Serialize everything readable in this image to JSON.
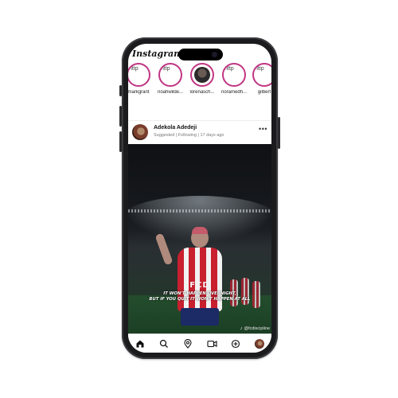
{
  "app": {
    "title": "Instagram"
  },
  "stories": [
    {
      "label": "markgrant",
      "image_text": "http"
    },
    {
      "label": "noahwilde...",
      "image_text": "http"
    },
    {
      "label": "lorenasch...",
      "image_text": ""
    },
    {
      "label": "noramedh...",
      "image_text": "http"
    },
    {
      "label": "gilbert",
      "image_text": "http"
    }
  ],
  "post": {
    "author": "Adekola Adedeji",
    "meta": "Suggested | Following | 17 days ago",
    "more": "•••",
    "image": {
      "brand": "FCD",
      "line1": "IT WON'T HAPPEN OVERNIGHT,",
      "line2": "BUT IF YOU QUIT IT WON'T HAPPEN AT ALL",
      "handle": "@fcdiscipline"
    }
  },
  "tabbar": {
    "items": [
      {
        "icon": "home-icon"
      },
      {
        "icon": "search-icon"
      },
      {
        "icon": "location-pin-icon"
      },
      {
        "icon": "video-camera-icon"
      },
      {
        "icon": "plus-circle-icon"
      },
      {
        "icon": "profile-avatar"
      }
    ]
  },
  "colors": {
    "story_ring": "#c13584",
    "text": "#111111",
    "phone": "#1b1b1d"
  }
}
